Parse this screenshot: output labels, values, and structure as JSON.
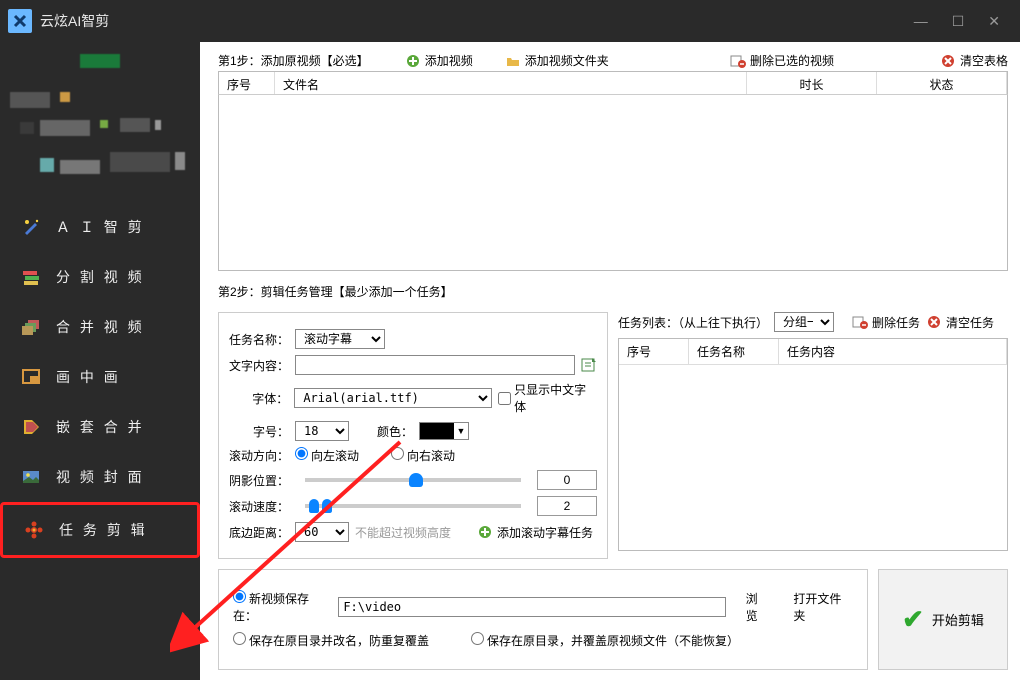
{
  "app": {
    "title": "云炫AI智剪"
  },
  "winctrl": {
    "min": "—",
    "max": "☐",
    "close": "✕"
  },
  "sidebar": {
    "items": [
      {
        "label": "Ａ Ｉ 智 剪"
      },
      {
        "label": "分 割 视 频"
      },
      {
        "label": "合 并 视 频"
      },
      {
        "label": "画 中 画"
      },
      {
        "label": "嵌 套 合 并"
      },
      {
        "label": "视 频 封 面"
      },
      {
        "label": "任 务 剪 辑"
      }
    ]
  },
  "step1": {
    "label": "第1步：添加原视频【必选】",
    "add_video": "添加视频",
    "add_folder": "添加视频文件夹",
    "del_selected": "删除已选的视频",
    "clear_table": "清空表格",
    "cols": {
      "seq": "序号",
      "filename": "文件名",
      "duration": "时长",
      "status": "状态"
    }
  },
  "step2": {
    "label": "第2步：剪辑任务管理【最少添加一个任务】",
    "task_name_label": "任务名称：",
    "task_name_value": "滚动字幕",
    "task_list_label": "任务列表：（从上往下执行）",
    "group_value": "分组一",
    "del_task": "删除任务",
    "clear_task": "清空任务",
    "text_label": "文字内容：",
    "font_label": "字体：",
    "font_value": "Arial(arial.ttf)",
    "only_cn": "只显示中文字体",
    "size_label": "字号：",
    "size_value": "18",
    "color_label": "颜色：",
    "scroll_dir_label": "滚动方向：",
    "dir_left": "向左滚动",
    "dir_right": "向右滚动",
    "shadow_label": "阴影位置：",
    "shadow_value": "0",
    "speed_label": "滚动速度：",
    "speed_value": "2",
    "bottom_label": "底边距离：",
    "bottom_value": "60",
    "bottom_hint": "不能超过视频高度",
    "add_scroll_task": "添加滚动字幕任务",
    "tl_cols": {
      "seq": "序号",
      "name": "任务名称",
      "content": "任务内容"
    }
  },
  "save": {
    "new_video_label": "新视频保存在：",
    "path": "F:\\video",
    "browse": "浏览",
    "open_folder": "打开文件夹",
    "rename": "保存在原目录并改名，防重复覆盖",
    "overwrite": "保存在原目录，并覆盖原视频文件（不能恢复）",
    "start": "开始剪辑"
  }
}
